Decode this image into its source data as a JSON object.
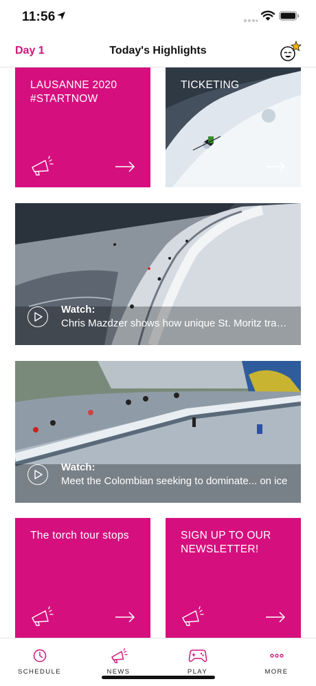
{
  "status": {
    "time": "11:56"
  },
  "nav": {
    "day": "Day 1",
    "title": "Today's Highlights"
  },
  "tiles": {
    "lausanne": "LAUSANNE 2020\n#STARTNOW",
    "ticketing": "TICKETING",
    "torch": "The torch tour stops",
    "newsletter": "SIGN UP TO OUR\nNEWSLETTER!"
  },
  "videos": [
    {
      "kicker": "Watch:",
      "caption": "Chris Mazdzer shows how unique St. Moritz track is..."
    },
    {
      "kicker": "Watch:",
      "caption": "Meet the Colombian seeking to dominate... on ice"
    }
  ],
  "tabbar": [
    {
      "label": "SCHEDULE",
      "icon": "clock-icon"
    },
    {
      "label": "NEWS",
      "icon": "megaphone-icon"
    },
    {
      "label": "PLAY",
      "icon": "gamepad-icon"
    },
    {
      "label": "MORE",
      "icon": "more-dots-icon"
    }
  ],
  "colors": {
    "brand_pink": "#d60f7e"
  }
}
